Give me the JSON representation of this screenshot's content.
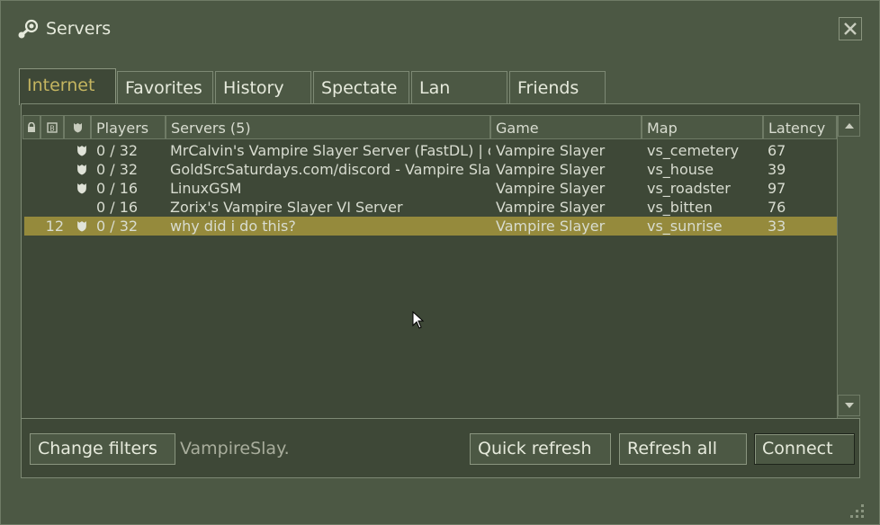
{
  "window": {
    "title": "Servers"
  },
  "tabs": [
    {
      "label": "Internet",
      "active": true
    },
    {
      "label": "Favorites",
      "active": false
    },
    {
      "label": "History",
      "active": false
    },
    {
      "label": "Spectate",
      "active": false
    },
    {
      "label": "Lan",
      "active": false
    },
    {
      "label": "Friends",
      "active": false
    }
  ],
  "columns": {
    "lock_icon": "lock-icon",
    "bots_icon": "bots-icon",
    "secure_icon": "shield-icon",
    "players": "Players",
    "servers": "Servers (5)",
    "game": "Game",
    "map": "Map",
    "latency": "Latency"
  },
  "rows": [
    {
      "bots": "",
      "secure": true,
      "players": "0 / 32",
      "server": "MrCalvin's Vampire Slayer Server (FastDL) | disco...",
      "game": "Vampire Slayer",
      "map": "vs_cemetery",
      "latency": "67",
      "selected": false
    },
    {
      "bots": "",
      "secure": true,
      "players": "0 / 32",
      "server": "GoldSrcSaturdays.com/discord - Vampire Slayer",
      "game": "Vampire Slayer",
      "map": "vs_house",
      "latency": "39",
      "selected": false
    },
    {
      "bots": "",
      "secure": true,
      "players": "0 / 16",
      "server": "LinuxGSM",
      "game": "Vampire Slayer",
      "map": "vs_roadster",
      "latency": "97",
      "selected": false
    },
    {
      "bots": "",
      "secure": false,
      "players": "0 / 16",
      "server": "Zorix's Vampire Slayer VI Server",
      "game": "Vampire Slayer",
      "map": "vs_bitten",
      "latency": "76",
      "selected": false
    },
    {
      "bots": "12",
      "secure": true,
      "players": "0 / 32",
      "server": "why did i do this?",
      "game": "Vampire Slayer",
      "map": "vs_sunrise",
      "latency": "33",
      "selected": true
    }
  ],
  "footer": {
    "change_filters": "Change filters",
    "filter_summary": "VampireSlay.",
    "quick_refresh": "Quick refresh",
    "refresh_all": "Refresh all",
    "connect": "Connect"
  },
  "colors": {
    "background": "#4c5844",
    "panel": "#3e4837",
    "selected_row": "#958a3c",
    "active_tab_text": "#c4b560"
  }
}
